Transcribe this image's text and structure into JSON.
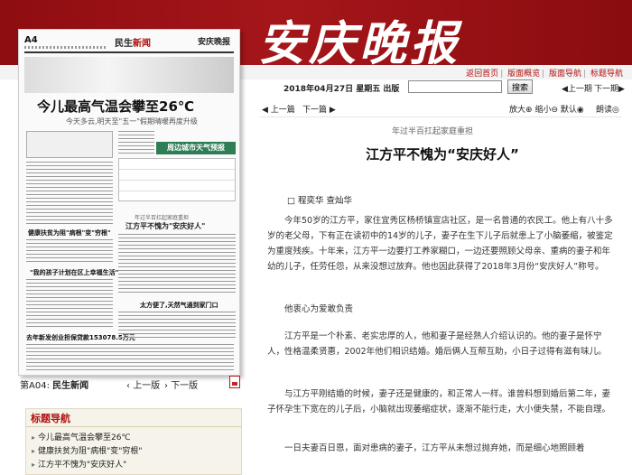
{
  "masthead": {
    "logo": "安庆晚报",
    "nav": [
      "返回首页",
      "版面概览",
      "版面导航",
      "标题导航"
    ]
  },
  "paper_preview": {
    "page_label": "A4",
    "section_prefix": "民生",
    "section_suffix": "新闻",
    "brand": "安庆晚报",
    "headline": "今儿最高气温会攀至26℃",
    "subline": "今天多云,明天至\"五一\"假期晴暖再度升级",
    "city_forecast_head": "周边城市天气预报",
    "side_headline_1": "健康扶贫为阻\"病根\"变\"穷根\"",
    "side_headline_2": "\"我的孩子计划在区上幸福生活\"",
    "bottom_headline": "去年新发创业担保贷款153078.5万元",
    "mid_pretitle": "年过半百扛起家庭重担",
    "mid_title": "江方平不愧为\"安庆好人\"",
    "lower_title": "太方便了,天然气通到家门口"
  },
  "page_nav": {
    "current_prefix": "第A04:",
    "current_name": "民生新闻",
    "prev": "上一版",
    "next": "下一版"
  },
  "title_nav": {
    "heading": "标题导航",
    "items": [
      "今儿最高气温会攀至26℃",
      "健康扶贫为阻\"病根\"变\"穷根\"",
      "江方平不愧为\"安庆好人\""
    ]
  },
  "toolbar": {
    "date": "2018年04月27日 星期五 出版",
    "search_value": "",
    "search_button": "搜索",
    "prev_edition": "上一期",
    "next_edition": "下一期"
  },
  "article_nav": {
    "prev": "上一篇",
    "next": "下一篇",
    "zoom_in": "放大",
    "zoom_out": "缩小",
    "reset": "默认",
    "read": "朗读"
  },
  "article": {
    "pretitle": "年过半百扛起家庭重担",
    "title": "江方平不愧为“安庆好人”",
    "author": "□ 程奕华 查灿华",
    "paragraphs": [
      "今年50岁的江方平，家住宜秀区杨桥镇宣店社区，是一名普通的农民工。他上有八十多岁的老父母，下有正在读初中的14岁的儿子，妻子在生下儿子后就患上了小脑萎缩，被鉴定为重度残疾。十年来，江方平一边要打工养家糊口，一边还要照顾父母亲、重病的妻子和年幼的儿子，任劳任怨，从来没想过放弃。他也因此获得了2018年3月份“安庆好人”称号。",
      "他衷心为爱敢负责",
      "江方平是一个朴素、老实忠厚的人，他和妻子是经熟人介绍认识的。他的妻子是怀宁人，性格温柔贤惠，2002年他们相识结婚。婚后俩人互帮互助，小日子过得有滋有味儿。",
      "与江方平刚结婚的时候，妻子还是健康的，和正常人一样。谁曾料想到婚后第二年，妻子怀孕生下宽在的儿子后，小脑就出现萎缩症状，逐渐不能行走，大小便失禁，不能自理。",
      "一日夫妻百日恩，面对患病的妻子，江方平从未想过抛弃她，而是细心地照顾着"
    ]
  }
}
